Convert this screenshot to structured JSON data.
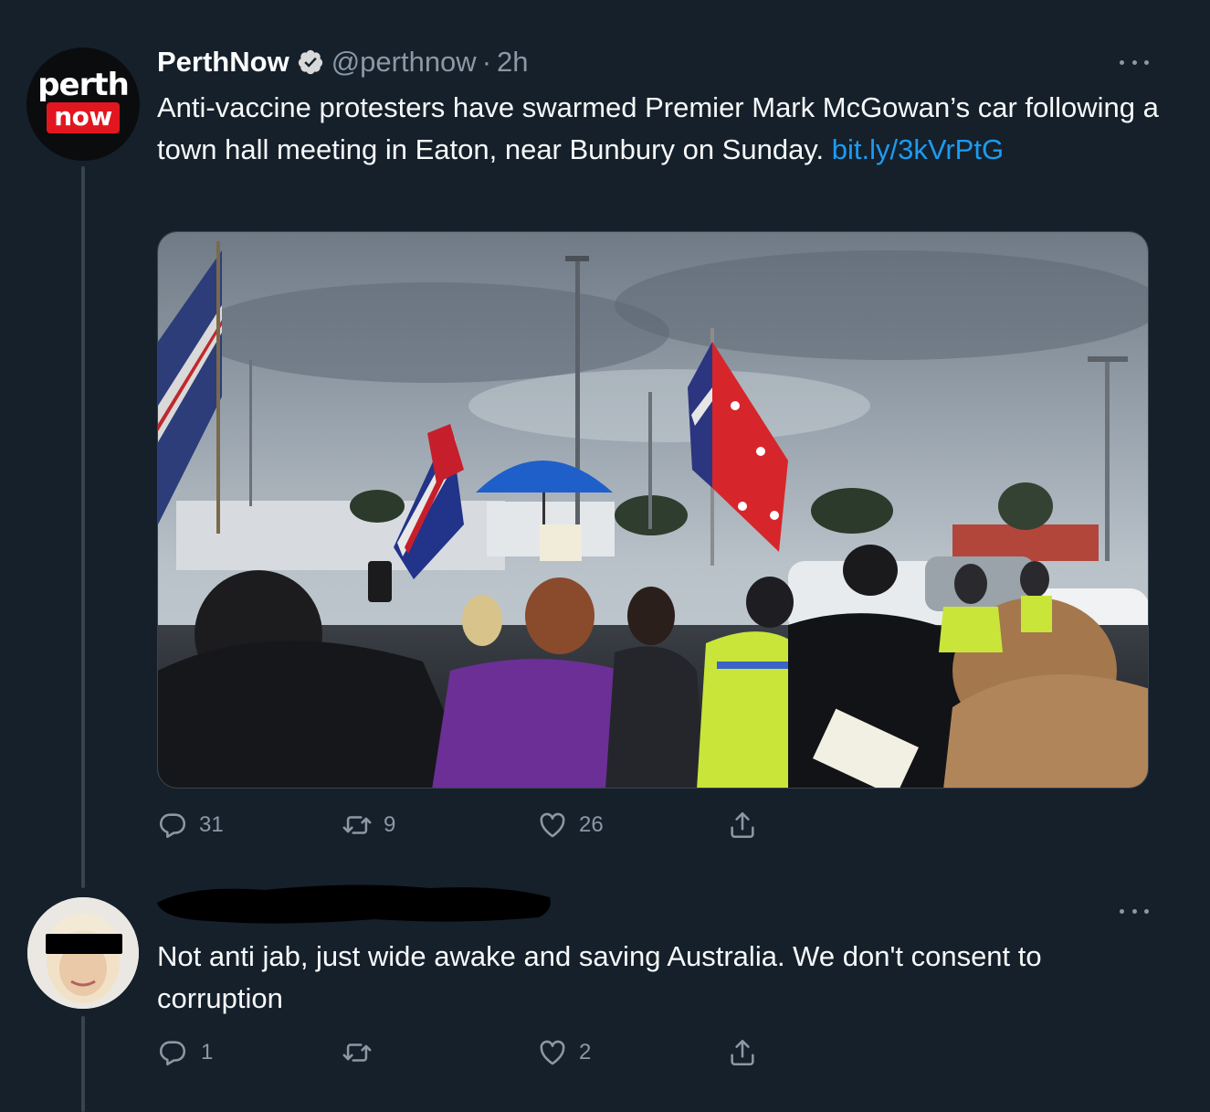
{
  "tweet": {
    "avatar": {
      "line1": "perth",
      "line2": "now"
    },
    "display_name": "PerthNow",
    "handle": "@perthnow",
    "separator": "·",
    "time": "2h",
    "text": "Anti-vaccine protesters have swarmed Premier Mark McGowan’s car following a town hall meeting in Eaton, near Bunbury on Sunday. ",
    "link_text": "bit.ly/3kVrPtG",
    "media_label": "protest-photo",
    "counts": {
      "reply": "31",
      "retweet": "9",
      "like": "26"
    }
  },
  "reply": {
    "display_name": "",
    "text": "Not anti jab, just wide awake and saving Australia. We don't consent to corruption",
    "counts": {
      "reply": "1",
      "retweet": "",
      "like": "2"
    }
  },
  "colors": {
    "background": "#15202b",
    "secondary_text": "#8b98a5",
    "link": "#1d9bf0",
    "verified": "#d9d9d9",
    "thread_line": "#38444d"
  },
  "icons": [
    "verified-badge-icon",
    "more-icon",
    "reply-icon",
    "retweet-icon",
    "like-icon",
    "share-icon"
  ]
}
